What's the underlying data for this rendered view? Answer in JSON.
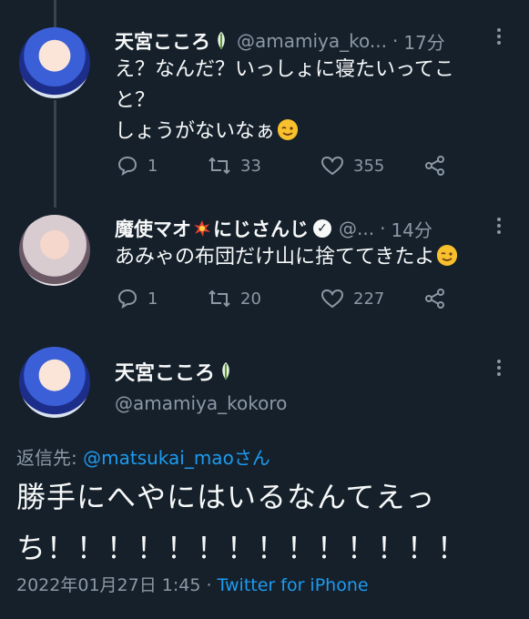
{
  "tweets": [
    {
      "name": "天宮こころ",
      "handle": "@amamiya_ko...",
      "time": "17分",
      "text_line1": "え？なんだ？いっしょに寝たいってこ",
      "text_line2": "と？",
      "text_line3": "しょうがないなぁ",
      "replies": "1",
      "retweets": "33",
      "likes": "355"
    },
    {
      "name_part1": "魔使マオ",
      "name_part2": "にじさんじ",
      "handle": "@...",
      "time": "14分",
      "text": "あみゃの布団だけ山に捨ててきたよ",
      "replies": "1",
      "retweets": "20",
      "likes": "227"
    }
  ],
  "main_tweet": {
    "name": "天宮こころ",
    "handle": "@amamiya_kokoro",
    "reply_prefix": "返信先: ",
    "reply_user": "@matsukai_mao",
    "reply_suffix": "さん",
    "text_line1": "勝手にへやにはいるなんてえっ",
    "text_line2": "ち！！！！！！！！！！！！！！",
    "datetime": "2022年01月27日 1:45 · ",
    "source": "Twitter for iPhone"
  },
  "colors": {
    "background": "#15202b",
    "text": "#f7f9f9",
    "secondary": "#8b98a5",
    "link": "#1d9bf0"
  },
  "icons": [
    "more-icon",
    "reply-icon",
    "retweet-icon",
    "like-icon",
    "share-icon",
    "leaf-icon",
    "verified-icon",
    "explosion-icon",
    "wink-emoji"
  ]
}
